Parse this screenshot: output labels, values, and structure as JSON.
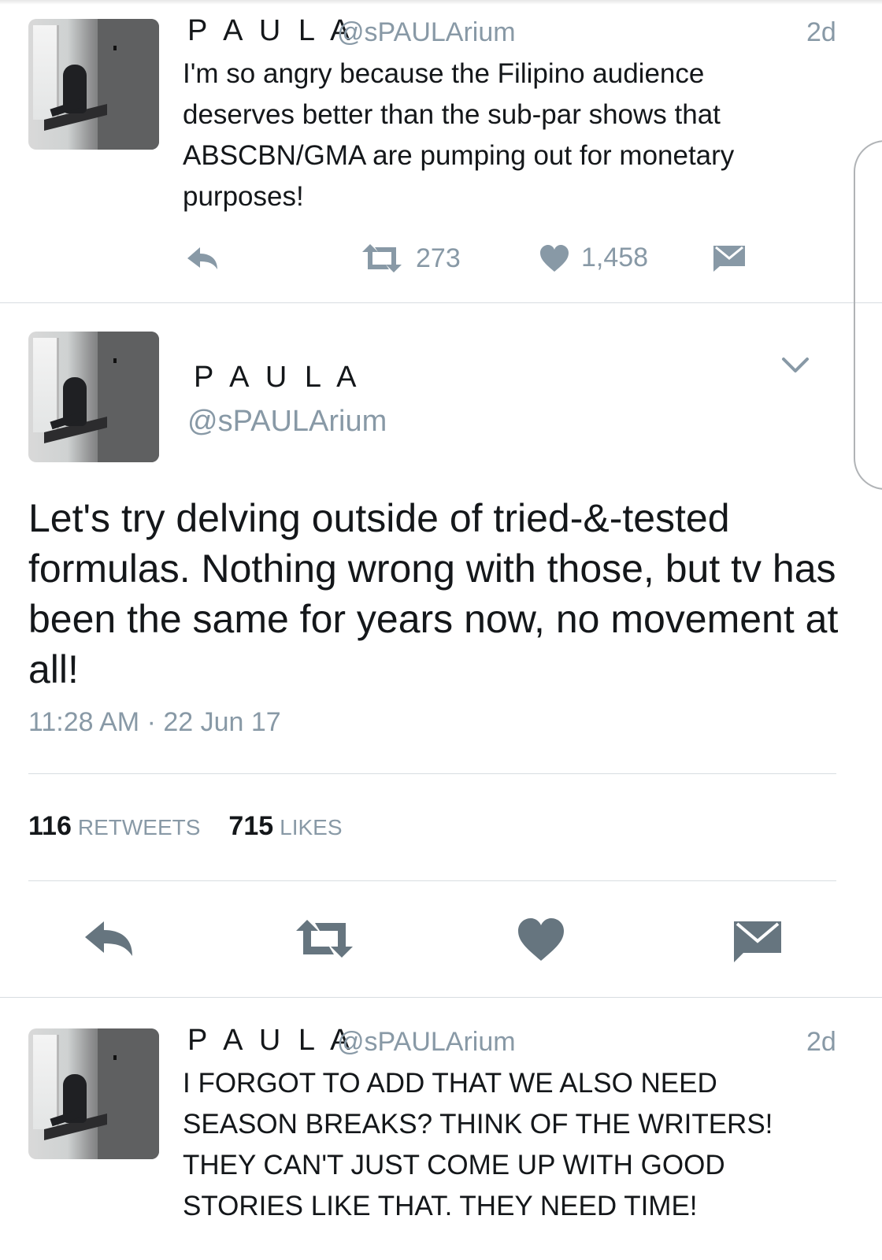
{
  "tweet1": {
    "name": "P A U L A",
    "handle": "@sPAULArium",
    "time": "2d",
    "text_lines": [
      "I'm so angry because the Filipino audience",
      "deserves better than the sub-par shows that",
      "ABSCBN/GMA are pumping out for monetary",
      "purposes!"
    ],
    "retweets": "273",
    "likes": "1,458"
  },
  "focus": {
    "name": "P A U L A",
    "handle": "@sPAULArium",
    "text_lines": [
      "Let's try delving outside of tried-&-tested",
      "formulas. Nothing wrong with those, but tv has",
      "been the same for years now, no movement at",
      "all!"
    ],
    "timestamp": "11:28 AM · 22 Jun 17",
    "retweet_count": "116",
    "retweet_label": "RETWEETS",
    "like_count": "715",
    "like_label": "LIKES"
  },
  "tweet3": {
    "name": "P A U L A",
    "handle": "@sPAULArium",
    "time": "2d",
    "text_lines": [
      "I FORGOT TO ADD THAT WE ALSO NEED",
      "SEASON BREAKS? THINK OF THE WRITERS!",
      "THEY CAN'T JUST COME UP WITH GOOD",
      "STORIES LIKE THAT. THEY NEED TIME!"
    ]
  },
  "icons": {
    "reply": "reply-icon",
    "retweet": "retweet-icon",
    "like": "heart-icon",
    "dm": "envelope-icon",
    "more": "chevron-down-icon"
  },
  "colors": {
    "text": "#14171a",
    "muted": "#8899a6",
    "icon_dark": "#66757f",
    "divider": "#d8dde1"
  }
}
